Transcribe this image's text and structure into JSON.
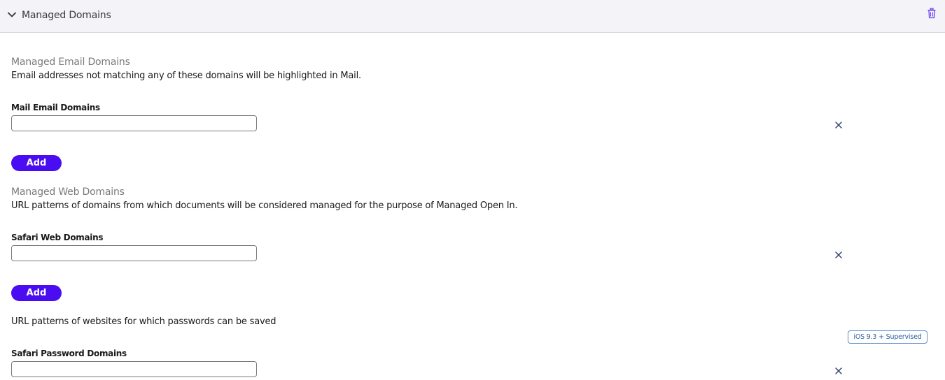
{
  "header": {
    "title": "Managed Domains",
    "collapse_icon": "chevron-down-icon",
    "delete_icon": "trash-icon",
    "accent_color": "#6b3cf0"
  },
  "email_section": {
    "title": "Managed Email Domains",
    "description": "Email addresses not matching any of these domains will be highlighted in Mail.",
    "field_label": "Mail Email Domains",
    "field_value": "",
    "add_label": "Add"
  },
  "web_section": {
    "title": "Managed Web Domains",
    "description": "URL patterns of domains from which documents will be considered managed for the purpose of Managed Open In.",
    "field_label": "Safari Web Domains",
    "field_value": "",
    "add_label": "Add"
  },
  "password_section": {
    "description": "URL patterns of websites for which passwords can be saved",
    "badge": "iOS 9.3 + Supervised",
    "field_label": "Safari Password Domains",
    "field_value": ""
  },
  "colors": {
    "button_bg": "#4a0df2",
    "header_bg": "#f4f4f8",
    "remove_icon": "#2b3a6b",
    "badge_border": "#5a8ec9"
  }
}
